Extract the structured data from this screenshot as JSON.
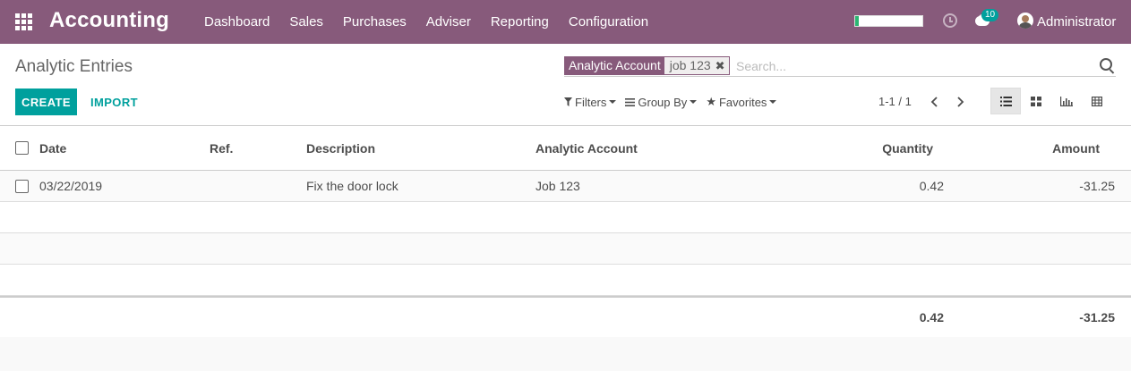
{
  "navbar": {
    "brand": "Accounting",
    "menu": [
      "Dashboard",
      "Sales",
      "Purchases",
      "Adviser",
      "Reporting",
      "Configuration"
    ],
    "chat_count": "10",
    "user": "Administrator",
    "progress_fraction": 0.05,
    "accent_color": "#875a7b"
  },
  "control": {
    "title": "Analytic Entries",
    "facet_label": "Analytic Account",
    "facet_value": "job 123",
    "search_placeholder": "Search...",
    "create_label": "CREATE",
    "import_label": "IMPORT",
    "filters_label": "Filters",
    "groupby_label": "Group By",
    "favorites_label": "Favorites",
    "pager": "1-1 / 1",
    "primary_color": "#00a09d"
  },
  "table": {
    "headers": {
      "date": "Date",
      "ref": "Ref.",
      "description": "Description",
      "account": "Analytic Account",
      "quantity": "Quantity",
      "amount": "Amount"
    },
    "rows": [
      {
        "date": "03/22/2019",
        "ref": "",
        "description": "Fix the door lock",
        "account": "Job 123",
        "quantity": "0.42",
        "amount": "-31.25"
      }
    ],
    "totals": {
      "quantity": "0.42",
      "amount": "-31.25"
    }
  }
}
